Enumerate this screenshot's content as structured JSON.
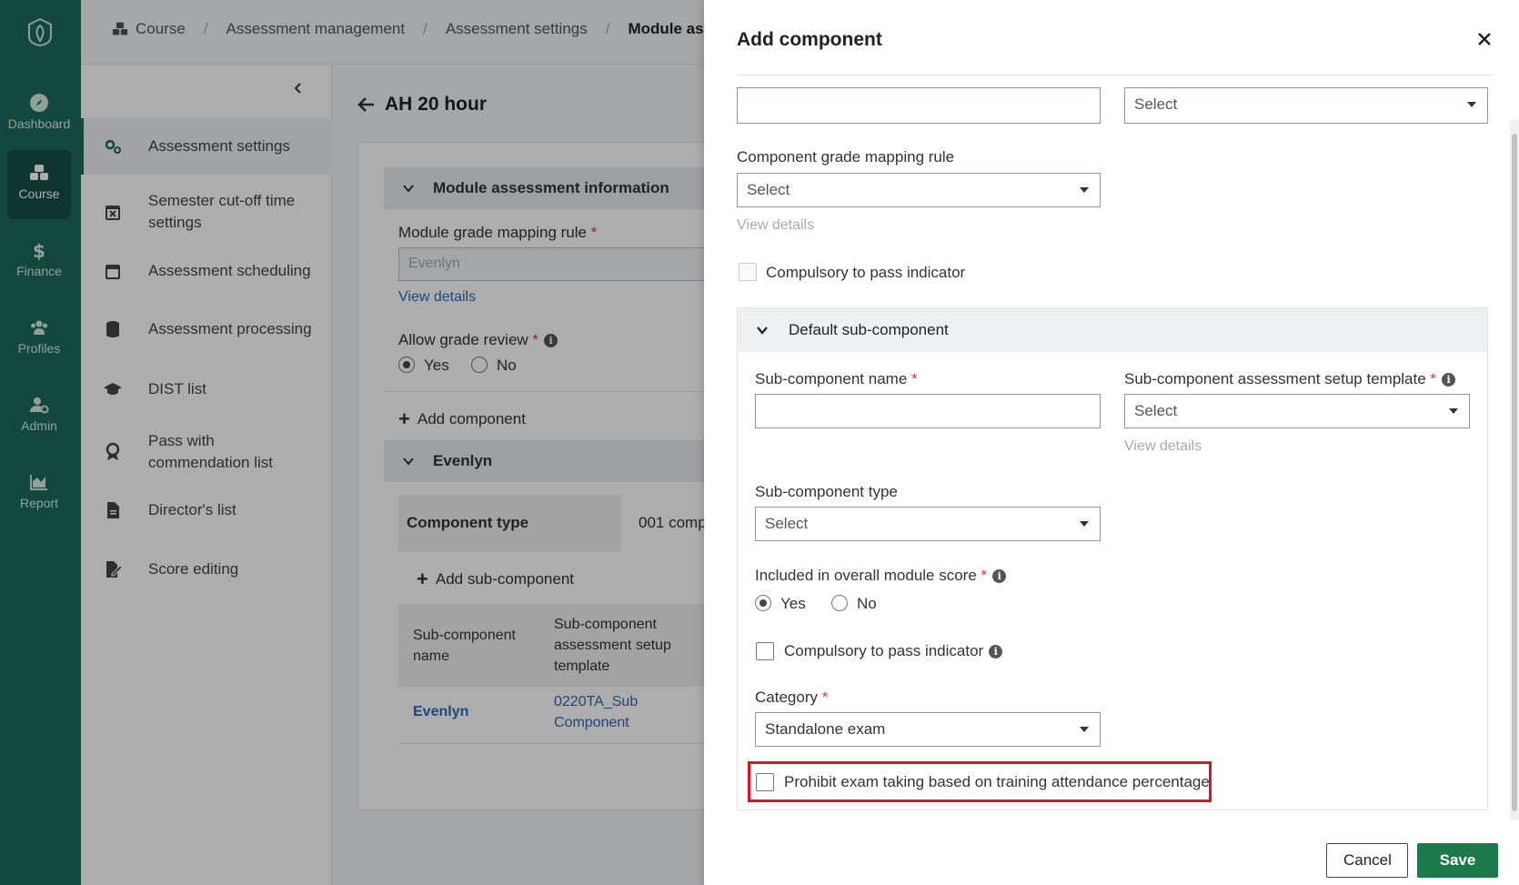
{
  "nav": {
    "items": [
      {
        "label": "Dashboard",
        "icon": "compass-icon"
      },
      {
        "label": "Course",
        "icon": "cubes-icon",
        "active": true
      },
      {
        "label": "Finance",
        "icon": "dollar-icon"
      },
      {
        "label": "Profiles",
        "icon": "users-icon"
      },
      {
        "label": "Admin",
        "icon": "user-gear-icon"
      },
      {
        "label": "Report",
        "icon": "chart-area-icon"
      }
    ]
  },
  "breadcrumb": {
    "items": [
      "Course",
      "Assessment management",
      "Assessment settings",
      "Module asse"
    ]
  },
  "subnav": {
    "items": [
      {
        "label": "Assessment settings",
        "icon": "gears-icon",
        "active": true
      },
      {
        "label": "Semester cut-off time settings",
        "icon": "calendar-x-icon"
      },
      {
        "label": "Assessment scheduling",
        "icon": "calendar-icon"
      },
      {
        "label": "Assessment processing",
        "icon": "database-icon"
      },
      {
        "label": "DIST list",
        "icon": "graduation-cap-icon"
      },
      {
        "label": "Pass with commendation list",
        "icon": "award-icon"
      },
      {
        "label": "Director's list",
        "icon": "file-icon"
      },
      {
        "label": "Score editing",
        "icon": "file-edit-icon"
      }
    ]
  },
  "main": {
    "title": "AH 20 hour",
    "section1": "Module assessment information",
    "module_grade_label": "Module grade mapping rule",
    "module_grade_value": "Evenlyn",
    "view_details": "View details",
    "allow_review_label": "Allow grade review",
    "yes": "Yes",
    "no": "No",
    "add_component": "Add component",
    "section2": "Evenlyn",
    "component_type_label": "Component type",
    "component_type_value": "001 comp",
    "add_sub_component": "Add sub-component",
    "table": {
      "col1": "Sub-component name",
      "col2": "Sub-component assessment setup template",
      "row_name": "Evenlyn",
      "row_template": "0220TA_Sub Component"
    }
  },
  "drawer": {
    "title": "Add component",
    "top_select": "Select",
    "grade_mapping_label": "Component grade mapping rule",
    "grade_mapping_select": "Select",
    "view_details": "View details",
    "compulsory_label": "Compulsory to pass indicator",
    "default_sub_heading": "Default sub-component",
    "sub_name_label": "Sub-component name",
    "sub_template_label": "Sub-component assessment setup template",
    "sub_template_select": "Select",
    "sub_view_details": "View details",
    "sub_type_label": "Sub-component type",
    "sub_type_select": "Select",
    "included_label": "Included in overall module score",
    "yes": "Yes",
    "no": "No",
    "sub_compulsory_label": "Compulsory to pass indicator",
    "category_label": "Category",
    "category_value": "Standalone exam",
    "prohibit_label": "Prohibit exam taking based on training attendance percentage",
    "cancel": "Cancel",
    "save": "Save"
  },
  "colors": {
    "rail": "#1c6b5c",
    "save_button": "#1c7a4a",
    "highlight": "#e0141e"
  }
}
